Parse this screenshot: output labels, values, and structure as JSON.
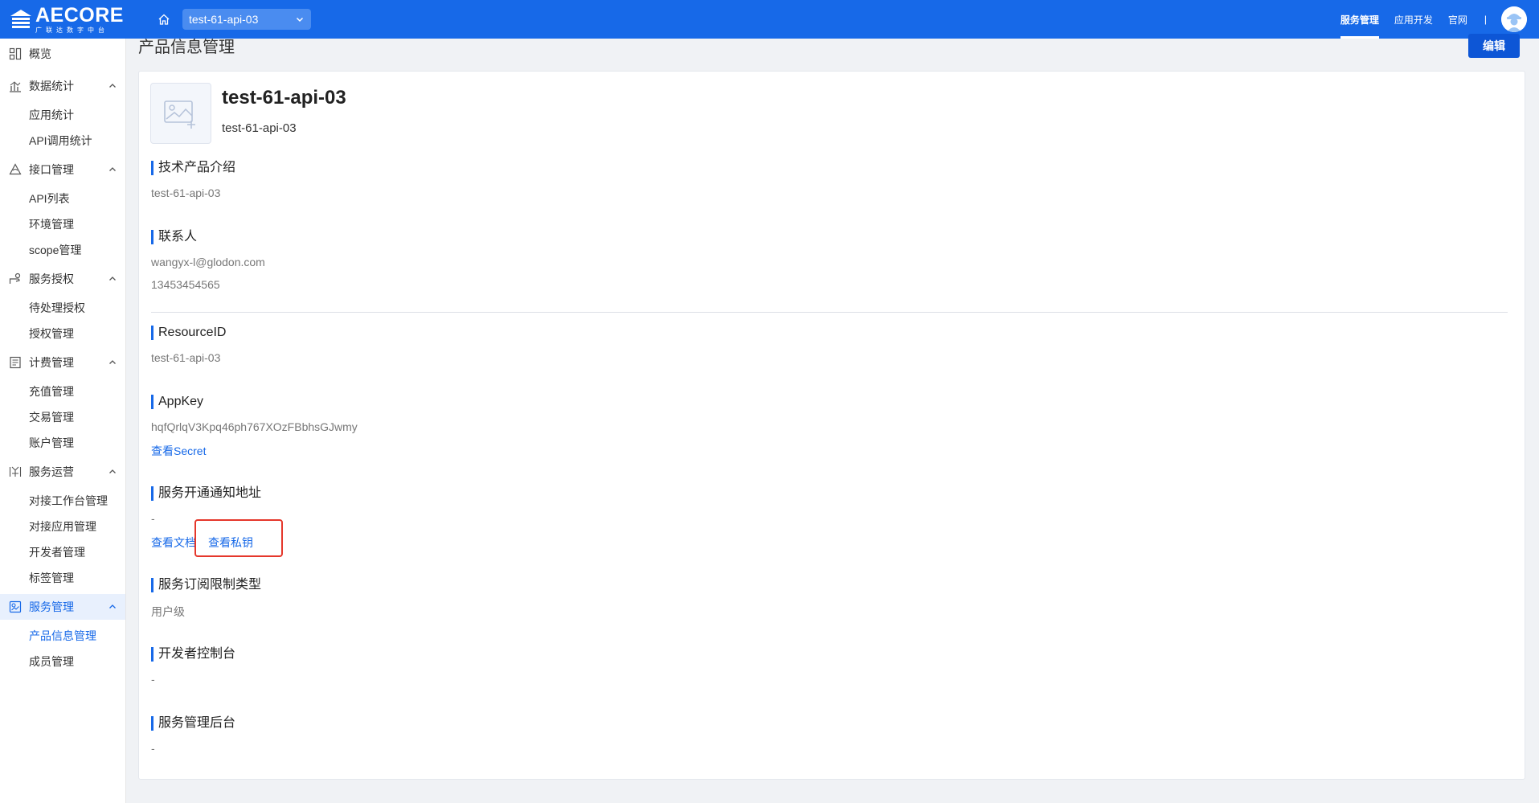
{
  "header": {
    "logo_text": "AECORE",
    "logo_subtext": "广联达数字中台",
    "project_select": "test-61-api-03",
    "nav": [
      {
        "label": "服务管理",
        "active": true
      },
      {
        "label": "应用开发",
        "active": false
      },
      {
        "label": "官网",
        "active": false
      }
    ],
    "separator": "|",
    "brand_color": "#1769e8"
  },
  "sidebar": {
    "overview": "概览",
    "groups": [
      {
        "title": "数据统计",
        "icon": "chart-bar-icon",
        "items": [
          "应用统计",
          "API调用统计"
        ]
      },
      {
        "title": "接口管理",
        "icon": "interface-icon",
        "items": [
          "API列表",
          "环境管理",
          "scope管理"
        ]
      },
      {
        "title": "服务授权",
        "icon": "authorization-icon",
        "items": [
          "待处理授权",
          "授权管理"
        ]
      },
      {
        "title": "计费管理",
        "icon": "billing-icon",
        "items": [
          "充值管理",
          "交易管理",
          "账户管理"
        ]
      },
      {
        "title": "服务运营",
        "icon": "operations-icon",
        "items": [
          "对接工作台管理",
          "对接应用管理",
          "开发者管理",
          "标签管理"
        ]
      },
      {
        "title": "服务管理",
        "icon": "service-icon",
        "items": [
          "产品信息管理",
          "成员管理"
        ]
      }
    ],
    "active_item": "产品信息管理"
  },
  "main": {
    "page_title": "产品信息管理",
    "edit_button": "编辑",
    "product": {
      "name": "test-61-api-03",
      "subtitle": "test-61-api-03"
    },
    "sections": {
      "intro": {
        "title": "技术产品介绍",
        "value": "test-61-api-03"
      },
      "contact": {
        "title": "联系人",
        "email": "wangyx-l@glodon.com",
        "phone": "13453454565"
      },
      "resource": {
        "title": "ResourceID",
        "value": "test-61-api-03"
      },
      "appkey": {
        "title": "AppKey",
        "value": "hqfQrlqV3Kpq46ph767XOzFBbhsGJwmy",
        "link": "查看Secret"
      },
      "notify": {
        "title": "服务开通通知地址",
        "value": "-",
        "doc_link": "查看文档",
        "key_link": "查看私钥"
      },
      "sub_type": {
        "title": "服务订阅限制类型",
        "value": "用户级"
      },
      "dev_console": {
        "title": "开发者控制台",
        "value": "-"
      },
      "admin": {
        "title": "服务管理后台",
        "value": "-"
      }
    }
  }
}
